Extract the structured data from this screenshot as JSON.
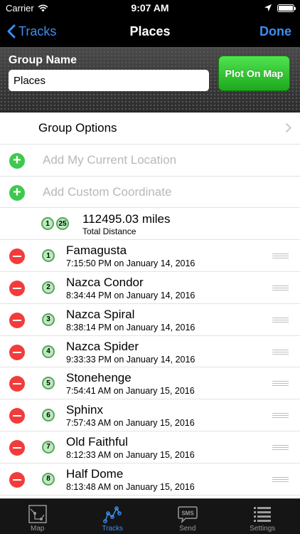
{
  "status": {
    "carrier": "Carrier",
    "time": "9:07 AM",
    "battery_level": 1.0
  },
  "nav": {
    "back_label": "Tracks",
    "title": "Places",
    "done_label": "Done"
  },
  "group": {
    "label": "Group Name",
    "value": "Places",
    "plot_label": "Plot On Map"
  },
  "list": {
    "options_label": "Group Options",
    "add_location_label": "Add My Current Location",
    "add_coordinate_label": "Add Custom Coordinate",
    "distance": {
      "start_badge": "1",
      "end_badge": "25",
      "value": "112495.03 miles",
      "caption": "Total Distance"
    },
    "places": [
      {
        "index": "1",
        "name": "Famagusta",
        "time": "7:15:50 PM on January 14, 2016"
      },
      {
        "index": "2",
        "name": "Nazca Condor",
        "time": "8:34:44 PM on January 14, 2016"
      },
      {
        "index": "3",
        "name": "Nazca Spiral",
        "time": "8:38:14 PM on January 14, 2016"
      },
      {
        "index": "4",
        "name": "Nazca Spider",
        "time": "9:33:33 PM on January 14, 2016"
      },
      {
        "index": "5",
        "name": "Stonehenge",
        "time": "7:54:41 AM on January 15, 2016"
      },
      {
        "index": "6",
        "name": "Sphinx",
        "time": "7:57:43 AM on January 15, 2016"
      },
      {
        "index": "7",
        "name": "Old Faithful",
        "time": "8:12:33 AM on January 15, 2016"
      },
      {
        "index": "8",
        "name": "Half Dome",
        "time": "8:13:48 AM on January 15, 2016"
      }
    ]
  },
  "tabs": [
    {
      "label": "Map",
      "icon": "map-icon"
    },
    {
      "label": "Tracks",
      "icon": "tracks-icon",
      "active": true
    },
    {
      "label": "Send",
      "icon": "sms-icon"
    },
    {
      "label": "Settings",
      "icon": "settings-list-icon"
    }
  ],
  "colors": {
    "accent": "#3d8ef0",
    "plot_green": "#2ec02e",
    "add_green": "#3ec94e",
    "remove_red": "#f23c3c"
  }
}
